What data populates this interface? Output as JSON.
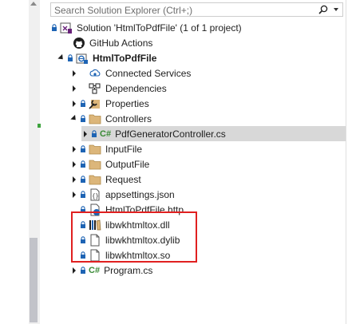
{
  "search": {
    "placeholder": "Search Solution Explorer (Ctrl+;)"
  },
  "tree": {
    "solution_label": "Solution 'HtmlToPdfFile' (1 of 1 project)",
    "github_actions_label": "GitHub Actions",
    "project_label": "HtmlToPdfFile",
    "connected_services_label": "Connected Services",
    "dependencies_label": "Dependencies",
    "properties_label": "Properties",
    "controllers_label": "Controllers",
    "cs_tag": "C#",
    "pdf_controller_label": "PdfGeneratorController.cs",
    "inputfile_label": "InputFile",
    "outputfile_label": "OutputFile",
    "request_label": "Request",
    "appsettings_label": "appsettings.json",
    "http_file_label": "HtmlToPdfFile.http",
    "dll_label": "libwkhtmltox.dll",
    "dylib_label": "libwkhtmltox.dylib",
    "so_label": "libwkhtmltox.so",
    "program_label": "Program.cs"
  },
  "icons": {
    "search": "search-icon",
    "lock": "lock-icon",
    "folder": "folder-icon",
    "file": "file-icon",
    "github": "github-icon",
    "project": "csharp-project-icon",
    "solution": "solution-icon",
    "cloud": "connected-services-icon",
    "dependencies": "dependencies-icon",
    "wrench": "properties-wrench-icon",
    "json": "json-file-icon",
    "http": "http-file-icon",
    "dll": "dll-file-icon"
  },
  "colors": {
    "folder": "#dcb67a",
    "lock": "#1e64b4",
    "cs_green": "#388a34",
    "selection": "#d8d8d8",
    "highlight_border": "#e02020",
    "change_marker": "#3ea33e"
  }
}
